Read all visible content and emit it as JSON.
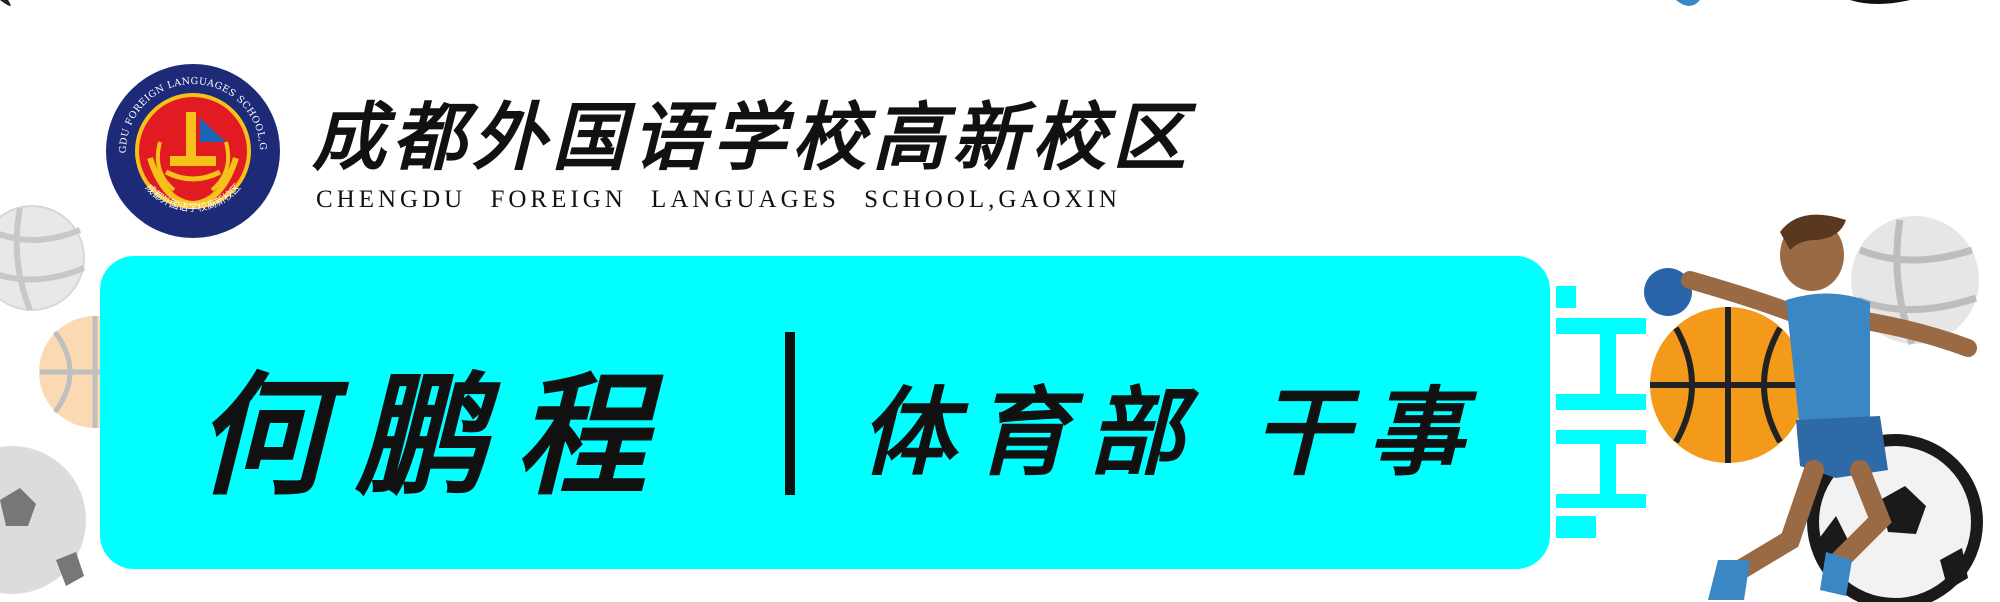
{
  "school": {
    "name_cn": "成都外国语学校高新校区",
    "name_en": "CHENGDU  FOREIGN  LANGUAGES  SCHOOL,GAOXIN",
    "seal_text_top": "CHENGDU FOREIGN LANGUAGES SCHOOL,GAOXIN",
    "seal_text_bottom": "成都外国语学校高新校区"
  },
  "person": {
    "name": "何鹏程",
    "role": "体育部  干事"
  },
  "colors": {
    "banner": "#00ffff",
    "logo_ring": "#1c2a78",
    "logo_inner": "#e21b23",
    "accent_orange": "#f39a1b",
    "skin": "#9a6a45",
    "shirt": "#3b87c4"
  },
  "icons": [
    "school-seal-icon",
    "volleyball-icon",
    "basketball-icon",
    "soccer-ball-icon",
    "player-figure-icon"
  ]
}
